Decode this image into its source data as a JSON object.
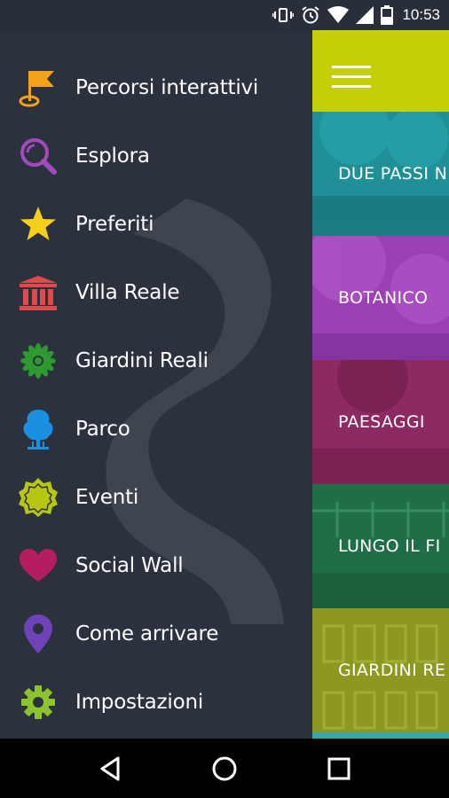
{
  "status_bar": {
    "time": "10:53",
    "icons": [
      "vibrate-icon",
      "alarm-icon",
      "wifi-icon",
      "signal-icon",
      "battery-icon"
    ]
  },
  "drawer": {
    "items": [
      {
        "label": "Percorsi interattivi",
        "icon": "flag-pin-icon",
        "color": "#f2a21b"
      },
      {
        "label": "Esplora",
        "icon": "search-icon",
        "color": "#a24bbf"
      },
      {
        "label": "Preferiti",
        "icon": "star-icon",
        "color": "#f6cf1a"
      },
      {
        "label": "Villa Reale",
        "icon": "building-icon",
        "color": "#e14a4a"
      },
      {
        "label": "Giardini Reali",
        "icon": "flower-icon",
        "color": "#2c9a2f"
      },
      {
        "label": "Parco",
        "icon": "tree-icon",
        "color": "#1b8fe0"
      },
      {
        "label": "Eventi",
        "icon": "badge-icon",
        "color": "#b7c711"
      },
      {
        "label": "Social Wall",
        "icon": "heart-icon",
        "color": "#b51d61"
      },
      {
        "label": "Come arrivare",
        "icon": "location-pin-icon",
        "color": "#6e43b8"
      },
      {
        "label": "Impostazioni",
        "icon": "gear-icon",
        "color": "#8dc42d"
      }
    ]
  },
  "app_bar": {
    "color": "#c5cf07",
    "menu_icon": "hamburger-menu-icon"
  },
  "tiles": [
    {
      "label": "DUE PASSI N",
      "color": "#1f8f98"
    },
    {
      "label": "BOTANICO",
      "color": "#9a3fb4"
    },
    {
      "label": "PAESAGGI",
      "color": "#8e2a63"
    },
    {
      "label": "LUNGO IL FI",
      "color": "#1f6e47"
    },
    {
      "label": "GIARDINI RE",
      "color": "#8c9820"
    }
  ],
  "nav_bar": {
    "buttons": [
      "back-icon",
      "home-icon",
      "recents-icon"
    ]
  }
}
